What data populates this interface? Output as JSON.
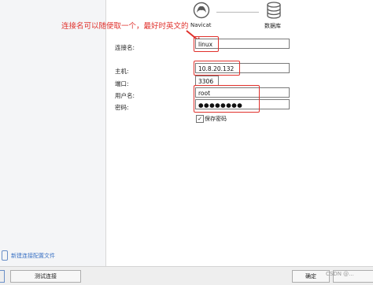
{
  "annotation": {
    "text": "连接名可以随便取一个，最好时英文的"
  },
  "steps": [
    {
      "label": "Navicat",
      "icon": "navicat-logo-icon"
    },
    {
      "label": "数据库",
      "icon": "database-icon"
    }
  ],
  "form": {
    "connection_name": {
      "label": "连接名:",
      "value": "linux"
    },
    "host": {
      "label": "主机:",
      "value": "10.8.20.132"
    },
    "port": {
      "label": "端口:",
      "value": "3306"
    },
    "username": {
      "label": "用户名:",
      "value": "root"
    },
    "password": {
      "label": "密码:",
      "value": "●●●●●●●●"
    },
    "save_password": {
      "label": "保存密码",
      "checked": true,
      "mark": "✓"
    }
  },
  "sidebar": {
    "new_profile_link": "新建连接配置文件"
  },
  "footer": {
    "test_button": "测试连接",
    "ok_button": "确定",
    "watermark": "CSDN @..."
  },
  "colors": {
    "annotation_red": "#e0312c",
    "link_blue": "#3b72c4"
  }
}
